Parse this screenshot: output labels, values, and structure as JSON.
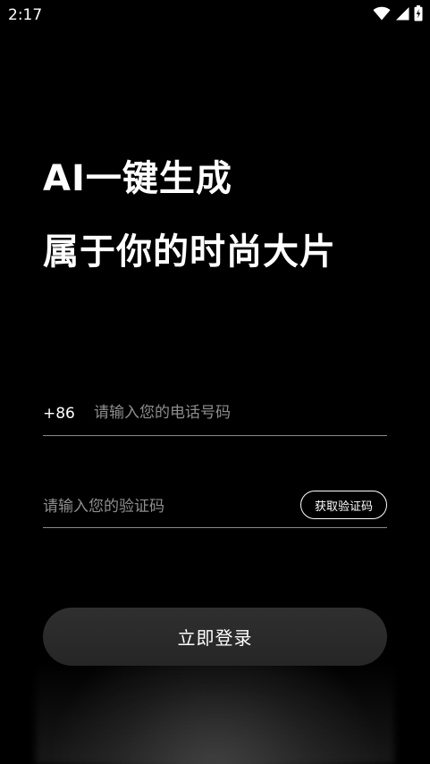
{
  "status_bar": {
    "time": "2:17",
    "icons": [
      "wifi-icon",
      "cellular-signal-icon",
      "battery-charging-icon"
    ]
  },
  "headline": {
    "line1": "AI一键生成",
    "line2": "属于你的时尚大片"
  },
  "phone_field": {
    "country_code": "+86",
    "placeholder": "请输入您的电话号码",
    "value": ""
  },
  "code_field": {
    "placeholder": "请输入您的验证码",
    "value": "",
    "send_code_label": "获取验证码"
  },
  "login_button": {
    "label": "立即登录"
  },
  "colors": {
    "background": "#000000",
    "text": "#ffffff",
    "placeholder": "#8e8e8e",
    "divider": "#8a8a8a",
    "button": "#2c2c2c"
  }
}
